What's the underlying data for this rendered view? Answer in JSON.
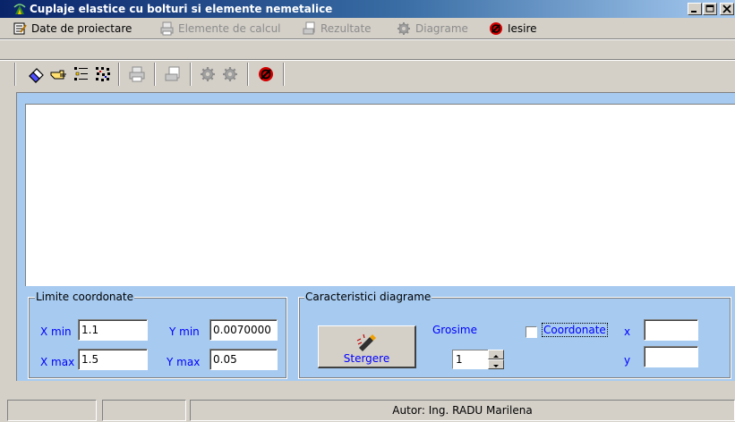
{
  "window": {
    "title": "Cuplaje elastice cu bolturi si elemente nemetalice",
    "controls": {
      "minimize": "_",
      "maximize": "□",
      "close": "×"
    }
  },
  "menu": {
    "items": [
      {
        "label": "Date de proiectare",
        "icon": "design-data-icon",
        "enabled": true
      },
      {
        "label": "Elemente de calcul",
        "icon": "printer-icon",
        "enabled": false
      },
      {
        "label": "Rezultate",
        "icon": "results-icon",
        "enabled": false
      },
      {
        "label": "Diagrame",
        "icon": "gear-icon",
        "enabled": false
      },
      {
        "label": "Iesire",
        "icon": "exit-icon",
        "enabled": true
      }
    ]
  },
  "toolbar": {
    "buttons": [
      "eraser-icon",
      "pointer-hand-icon",
      "list-icon",
      "dots-icon",
      "printer-icon",
      "results-icon",
      "gear-icon",
      "gear-icon",
      "exit-icon"
    ]
  },
  "limits": {
    "legend": "Limite coordonate",
    "xmin_label": "X min",
    "xmin_value": "1.1",
    "xmax_label": "X max",
    "xmax_value": "1.5",
    "ymin_label": "Y min",
    "ymin_value": "0.0070000",
    "ymax_label": "Y max",
    "ymax_value": "0.05"
  },
  "diagram": {
    "legend": "Caracteristici diagrame",
    "clear_button": "Stergere",
    "thickness_label": "Grosime",
    "thickness_value": "1",
    "coords_label": "Coordonate",
    "coords_checked": false,
    "x_label": "x",
    "x_value": "",
    "y_label": "y",
    "y_value": ""
  },
  "status": {
    "panes": [
      "",
      "",
      "Autor: Ing. RADU Marilena"
    ]
  },
  "colors": {
    "client_bg": "#a6caf0",
    "title_start": "#0a246a",
    "label_blue": "#0000ff",
    "face": "#d4d0c8"
  }
}
